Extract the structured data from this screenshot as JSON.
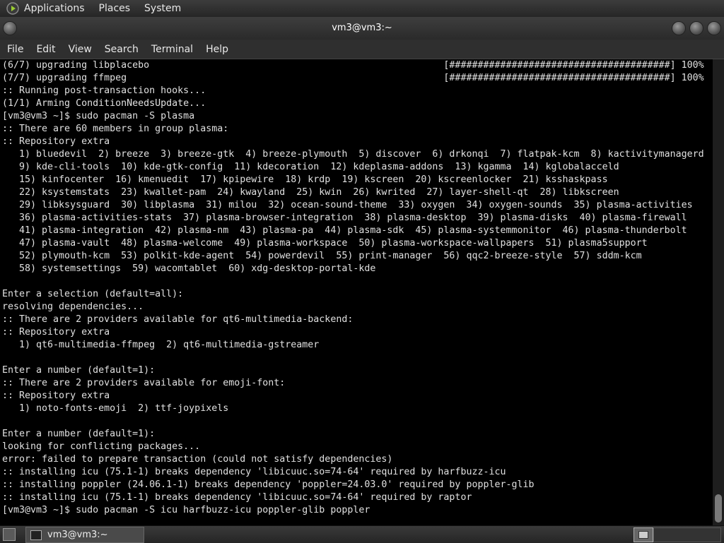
{
  "top_panel": {
    "menus": [
      "Applications",
      "Places",
      "System"
    ]
  },
  "window": {
    "title": "vm3@vm3:~",
    "menu": [
      "File",
      "Edit",
      "View",
      "Search",
      "Terminal",
      "Help"
    ]
  },
  "terminal": {
    "lines": [
      "(6/7) upgrading libplacebo                                                    [#######################################] 100%",
      "(7/7) upgrading ffmpeg                                                        [#######################################] 100%",
      ":: Running post-transaction hooks...",
      "(1/1) Arming ConditionNeedsUpdate...",
      "[vm3@vm3 ~]$ sudo pacman -S plasma",
      ":: There are 60 members in group plasma:",
      ":: Repository extra",
      "   1) bluedevil  2) breeze  3) breeze-gtk  4) breeze-plymouth  5) discover  6) drkonqi  7) flatpak-kcm  8) kactivitymanagerd",
      "   9) kde-cli-tools  10) kde-gtk-config  11) kdecoration  12) kdeplasma-addons  13) kgamma  14) kglobalacceld",
      "   15) kinfocenter  16) kmenuedit  17) kpipewire  18) krdp  19) kscreen  20) kscreenlocker  21) ksshaskpass",
      "   22) ksystemstats  23) kwallet-pam  24) kwayland  25) kwin  26) kwrited  27) layer-shell-qt  28) libkscreen",
      "   29) libksysguard  30) libplasma  31) milou  32) ocean-sound-theme  33) oxygen  34) oxygen-sounds  35) plasma-activities",
      "   36) plasma-activities-stats  37) plasma-browser-integration  38) plasma-desktop  39) plasma-disks  40) plasma-firewall",
      "   41) plasma-integration  42) plasma-nm  43) plasma-pa  44) plasma-sdk  45) plasma-systemmonitor  46) plasma-thunderbolt",
      "   47) plasma-vault  48) plasma-welcome  49) plasma-workspace  50) plasma-workspace-wallpapers  51) plasma5support",
      "   52) plymouth-kcm  53) polkit-kde-agent  54) powerdevil  55) print-manager  56) qqc2-breeze-style  57) sddm-kcm",
      "   58) systemsettings  59) wacomtablet  60) xdg-desktop-portal-kde",
      "",
      "Enter a selection (default=all):",
      "resolving dependencies...",
      ":: There are 2 providers available for qt6-multimedia-backend:",
      ":: Repository extra",
      "   1) qt6-multimedia-ffmpeg  2) qt6-multimedia-gstreamer",
      "",
      "Enter a number (default=1):",
      ":: There are 2 providers available for emoji-font:",
      ":: Repository extra",
      "   1) noto-fonts-emoji  2) ttf-joypixels",
      "",
      "Enter a number (default=1):",
      "looking for conflicting packages...",
      "error: failed to prepare transaction (could not satisfy dependencies)",
      ":: installing icu (75.1-1) breaks dependency 'libicuuc.so=74-64' required by harfbuzz-icu",
      ":: installing poppler (24.06.1-1) breaks dependency 'poppler=24.03.0' required by poppler-glib",
      ":: installing icu (75.1-1) breaks dependency 'libicuuc.so=74-64' required by raptor",
      "[vm3@vm3 ~]$ sudo pacman -S icu harfbuzz-icu poppler-glib poppler"
    ]
  },
  "taskbar": {
    "window_label": "vm3@vm3:~"
  }
}
